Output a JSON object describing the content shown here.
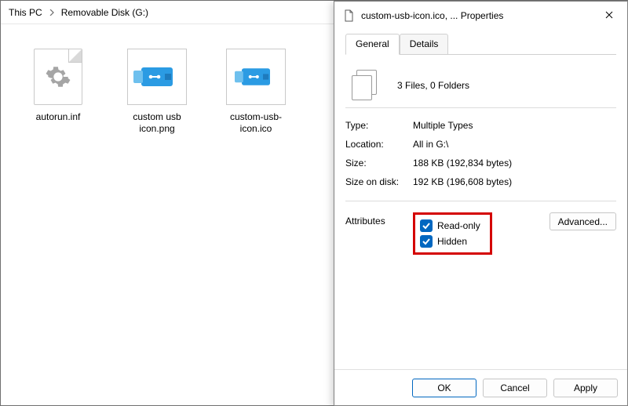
{
  "breadcrumb": {
    "items": [
      "This PC",
      "Removable Disk (G:)"
    ]
  },
  "files": [
    {
      "name": "autorun.inf",
      "kind": "inf"
    },
    {
      "name": "custom usb icon.png",
      "kind": "png"
    },
    {
      "name": "custom-usb-icon.ico",
      "kind": "ico"
    }
  ],
  "dialog": {
    "title": "custom-usb-icon.ico, ... Properties",
    "close_tooltip": "Close",
    "tabs": {
      "general": "General",
      "details": "Details",
      "active": "General"
    },
    "summary": "3 Files, 0 Folders",
    "rows": {
      "type_label": "Type:",
      "type_value": "Multiple Types",
      "location_label": "Location:",
      "location_value": "All in G:\\",
      "size_label": "Size:",
      "size_value": "188 KB (192,834 bytes)",
      "size_on_disk_label": "Size on disk:",
      "size_on_disk_value": "192 KB (196,608 bytes)"
    },
    "attributes": {
      "label": "Attributes",
      "read_only": "Read-only",
      "hidden": "Hidden",
      "advanced": "Advanced..."
    },
    "buttons": {
      "ok": "OK",
      "cancel": "Cancel",
      "apply": "Apply"
    }
  }
}
